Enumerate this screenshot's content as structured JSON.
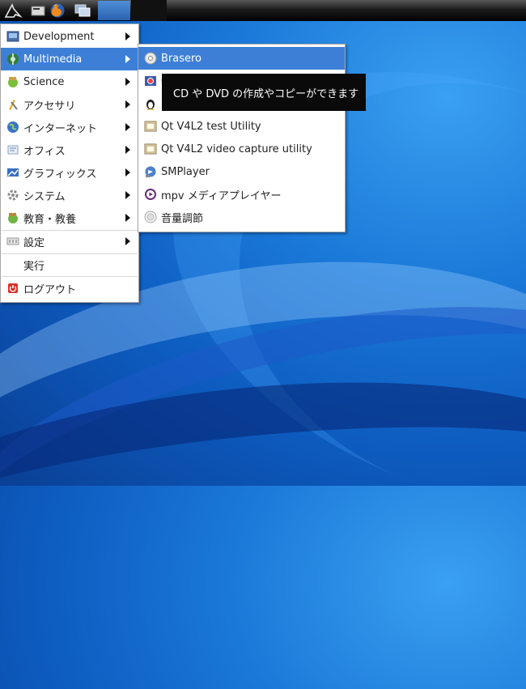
{
  "panel": {
    "icons": [
      "lxde-logo-icon",
      "terminal-icon",
      "firefox-icon",
      "window-switch-icon"
    ]
  },
  "main_menu": {
    "items": [
      {
        "label": "Development",
        "icon": "development-icon",
        "submenu": true
      },
      {
        "label": "Multimedia",
        "icon": "multimedia-icon",
        "submenu": true,
        "selected": true
      },
      {
        "label": "Science",
        "icon": "science-icon",
        "submenu": true
      },
      {
        "label": "アクセサリ",
        "icon": "accessories-icon",
        "submenu": true
      },
      {
        "label": "インターネット",
        "icon": "internet-icon",
        "submenu": true
      },
      {
        "label": "オフィス",
        "icon": "office-icon",
        "submenu": true
      },
      {
        "label": "グラフィックス",
        "icon": "graphics-icon",
        "submenu": true
      },
      {
        "label": "システム",
        "icon": "system-icon",
        "submenu": true
      },
      {
        "label": "教育・教養",
        "icon": "education-icon",
        "submenu": true
      },
      {
        "label": "設定",
        "icon": "settings-icon",
        "submenu": true
      },
      {
        "label": "実行",
        "icon": "",
        "submenu": false
      },
      {
        "label": "ログアウト",
        "icon": "logout-icon",
        "submenu": false
      }
    ]
  },
  "multimedia_menu": {
    "items": [
      {
        "label": "Brasero",
        "icon": "brasero-icon",
        "selected": true
      },
      {
        "label": "C",
        "icon": "cheese-icon"
      },
      {
        "label": "L",
        "icon": "linux-media-icon"
      },
      {
        "label": "Qt V4L2 test Utility",
        "icon": "qv4l2-icon"
      },
      {
        "label": "Qt V4L2 video capture utility",
        "icon": "qvidcap-icon"
      },
      {
        "label": "SMPlayer",
        "icon": "smplayer-icon"
      },
      {
        "label": "mpv メディアプレイヤー",
        "icon": "mpv-icon"
      },
      {
        "label": "音量調節",
        "icon": "volume-icon"
      }
    ]
  },
  "tooltip": {
    "text": "CD や DVD の作成やコピーができます"
  },
  "colors": {
    "selection": "#3d7fd6",
    "panel": "#1c1c1c",
    "desktop": "#1a78d8"
  }
}
